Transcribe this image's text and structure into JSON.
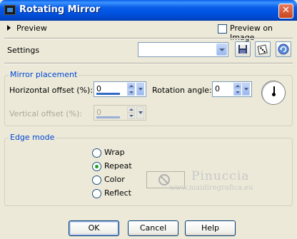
{
  "window": {
    "title": "Rotating Mirror",
    "close_glyph": "✕"
  },
  "preview": {
    "label": "Preview",
    "preview_on_image_label": "Preview on Image",
    "preview_on_image_checked": false
  },
  "settings": {
    "label": "Settings",
    "preset_value": "",
    "icons": [
      "save-icon",
      "randomize-dice-icon",
      "reset-icon"
    ]
  },
  "mirror_placement": {
    "legend": "Mirror placement",
    "horizontal_offset_label": "Horizontal offset (%):",
    "horizontal_offset_value": "0",
    "vertical_offset_label": "Vertical offset (%):",
    "vertical_offset_value": "0",
    "rotation_angle_label": "Rotation angle:",
    "rotation_angle_value": "0"
  },
  "edge_mode": {
    "legend": "Edge mode",
    "options": [
      {
        "label": "Wrap",
        "selected": false
      },
      {
        "label": "Repeat",
        "selected": true
      },
      {
        "label": "Color",
        "selected": false
      },
      {
        "label": "Reflect",
        "selected": false
      }
    ]
  },
  "watermark": {
    "name": "Pinuccia",
    "url": "www.maidiregrafica.eu"
  },
  "buttons": {
    "ok": "OK",
    "cancel": "Cancel",
    "help": "Help"
  },
  "colors": {
    "titlebar": "#0054e3",
    "dialog_bg": "#ece9d8",
    "group_label": "#0046d5",
    "selected_radio": "#21a121"
  }
}
